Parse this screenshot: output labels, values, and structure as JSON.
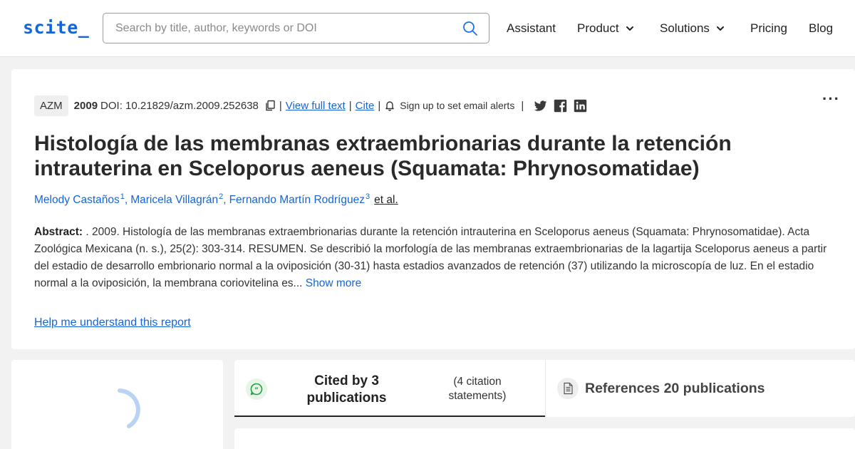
{
  "header": {
    "logo": "scite_",
    "search": {
      "placeholder": "Search by title, author, keywords or DOI",
      "value": ""
    },
    "nav": [
      {
        "label": "Assistant",
        "has_dropdown": false
      },
      {
        "label": "Product",
        "has_dropdown": true
      },
      {
        "label": "Solutions",
        "has_dropdown": true
      },
      {
        "label": "Pricing",
        "has_dropdown": false
      },
      {
        "label": "Blog",
        "has_dropdown": false
      }
    ]
  },
  "article": {
    "journal": "AZM",
    "year": "2009",
    "doi": "DOI: 10.21829/azm.2009.252638",
    "view_full_text": "View full text",
    "cite": "Cite",
    "email_alerts": "Sign up to set email alerts",
    "more_menu": "···",
    "title": "Histología de las membranas extraembrionarias durante la retención intrauterina en Sceloporus aeneus (Squamata: Phrynosomatidae)",
    "authors": [
      {
        "name": "Melody Castaños",
        "sup": "1"
      },
      {
        "name": "Maricela Villagrán",
        "sup": "2"
      },
      {
        "name": "Fernando Martín Rodríguez",
        "sup": "3"
      }
    ],
    "et_al": "et al.",
    "abstract_label": "Abstract:",
    "abstract_text": " . 2009. Histología de las membranas extraembrionarias durante la retención intrauterina en Sceloporus aeneus (Squamata: Phrynosomatidae). Acta Zoológica Mexicana (n. s.), 25(2): 303-314. RESUMEN. Se describió la morfología de las membranas extraembrionarias de la lagartija Sceloporus aeneus a partir del estadio de desarrollo embrionario normal a la oviposición (30-31) hasta estadios avanzados de retención (37) utilizando la microscopía de luz. En el estadio normal a la oviposición, la membrana coriovitelina es...",
    "show_more": "Show more",
    "help_link": "Help me understand this report"
  },
  "tabs": {
    "cited_by": "Cited by 3 publications",
    "citation_statements": "(4 citation statements)",
    "references": "References 20 publications"
  },
  "colors": {
    "accent": "#1565d8",
    "cited_icon": "#2e9e46"
  },
  "icons": {
    "search": "search-icon",
    "copy": "copy-icon",
    "bell": "bell-icon",
    "twitter": "twitter-icon",
    "facebook": "facebook-icon",
    "linkedin": "linkedin-icon",
    "cited": "chat-quote-icon",
    "references": "document-icon"
  }
}
